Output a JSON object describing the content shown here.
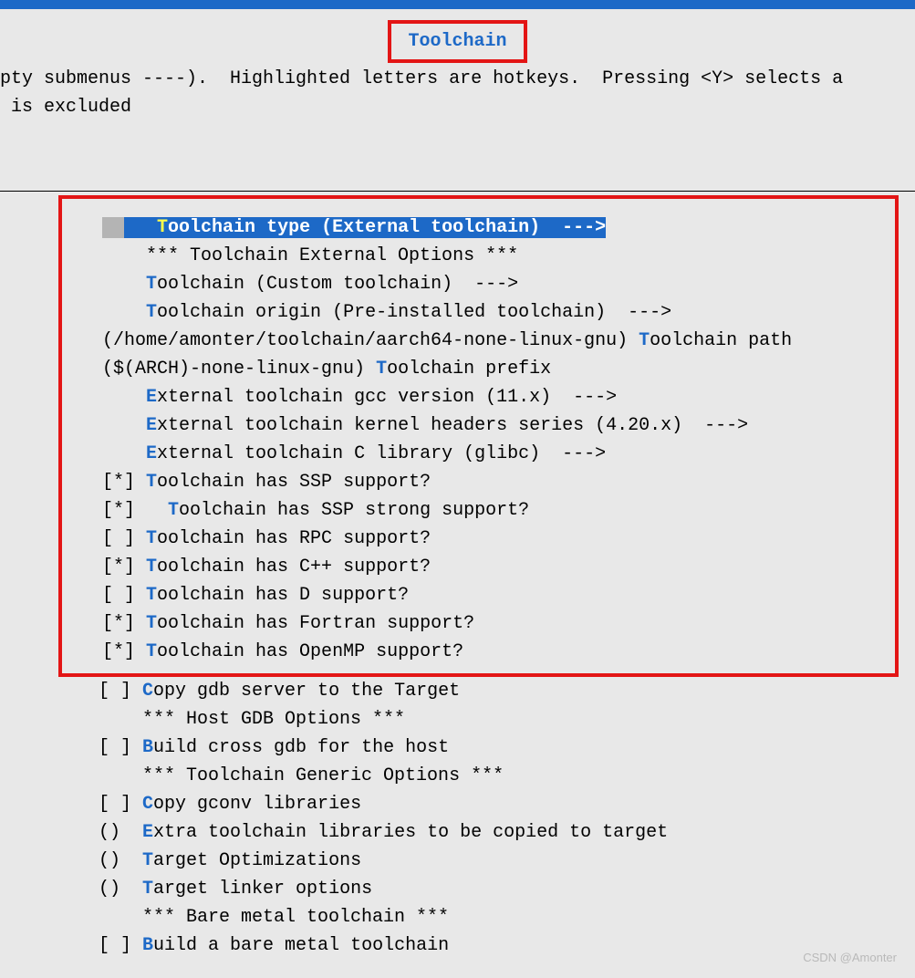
{
  "title": "Toolchain",
  "help": {
    "line1_a": "pty submenus ----).  Highlighted letters are hotkeys.  Pressing <Y> selects a",
    "line2_a": " is excluded"
  },
  "selected": {
    "prefix": "  ",
    "pad": "   ",
    "hot": "T",
    "rest": "oolchain type (External toolchain)  --->"
  },
  "lines": {
    "ext_opts": "    *** Toolchain External Options ***",
    "l_custom_pre": "    ",
    "l_custom_hot": "T",
    "l_custom_rest": "oolchain (Custom toolchain)  --->",
    "l_origin_pre": "    ",
    "l_origin_hot": "T",
    "l_origin_rest": "oolchain origin (Pre-installed toolchain)  --->",
    "l_path_a": "(/home/amonter/toolchain/aarch64-none-linux-gnu) ",
    "l_path_hot": "T",
    "l_path_b": "oolchain path",
    "l_prefix_a": "($(ARCH)-none-linux-gnu) ",
    "l_prefix_hot": "T",
    "l_prefix_b": "oolchain prefix",
    "l_gcc_pre": "    ",
    "l_gcc_hot": "E",
    "l_gcc_rest": "xternal toolchain gcc version (11.x)  --->",
    "l_khdr_pre": "    ",
    "l_khdr_hot": "E",
    "l_khdr_rest": "xternal toolchain kernel headers series (4.20.x)  --->",
    "l_clib_pre": "    ",
    "l_clib_hot": "E",
    "l_clib_rest": "xternal toolchain C library (glibc)  --->",
    "l_ssp_pre": "[*] ",
    "l_ssp_hot": "T",
    "l_ssp_rest": "oolchain has SSP support?",
    "l_ssps_pre": "[*]   ",
    "l_ssps_hot": "T",
    "l_ssps_rest": "oolchain has SSP strong support?",
    "l_rpc_pre": "[ ] ",
    "l_rpc_hot": "T",
    "l_rpc_rest": "oolchain has RPC support?",
    "l_cpp_pre": "[*] ",
    "l_cpp_hot": "T",
    "l_cpp_rest": "oolchain has C++ support?",
    "l_d_pre": "[ ] ",
    "l_d_hot": "T",
    "l_d_rest": "oolchain has D support?",
    "l_for_pre": "[*] ",
    "l_for_hot": "T",
    "l_for_rest": "oolchain has Fortran support?",
    "l_omp_pre": "[*] ",
    "l_omp_hot": "T",
    "l_omp_rest": "oolchain has OpenMP support?",
    "l_gdbsrv_pre": "[ ] ",
    "l_gdbsrv_hot": "C",
    "l_gdbsrv_rest": "opy gdb server to the Target",
    "l_hostgdb_opts": "    *** Host GDB Options ***",
    "l_bcg_pre": "[ ] ",
    "l_bcg_hot": "B",
    "l_bcg_rest": "uild cross gdb for the host",
    "l_generic": "    *** Toolchain Generic Options ***",
    "l_gconv_pre": "[ ] ",
    "l_gconv_hot": "C",
    "l_gconv_rest": "opy gconv libraries",
    "l_extra_pre": "()  ",
    "l_extra_hot": "E",
    "l_extra_rest": "xtra toolchain libraries to be copied to target",
    "l_topt_pre": "()  ",
    "l_topt_hot": "T",
    "l_topt_rest": "arget Optimizations",
    "l_tlink_pre": "()  ",
    "l_tlink_hot": "T",
    "l_tlink_rest": "arget linker options",
    "l_bare_hdr": "    *** Bare metal toolchain ***",
    "l_bare_pre": "[ ] ",
    "l_bare_hot": "B",
    "l_bare_rest": "uild a bare metal toolchain"
  },
  "watermark": "CSDN @Amonter"
}
